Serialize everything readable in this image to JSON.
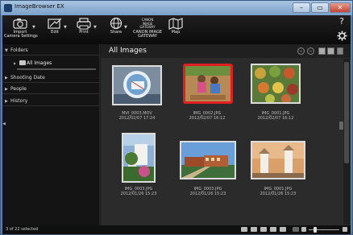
{
  "window": {
    "title": "ImageBrowser EX",
    "controls": {
      "min": "–",
      "max": "▭",
      "close": "✕"
    }
  },
  "toolbar": {
    "import_label": "Import\nCamera Settings",
    "edit_label": "Edit",
    "print_label": "Print",
    "share_label": "Share",
    "gateway_logo": "CANON\niMAGE\nGATEWAY",
    "gateway_label": "CANON iMAGE\nGATEWAY",
    "map_label": "Map",
    "help_label": "?",
    "settings_icon": "gear-icon"
  },
  "sidebar": {
    "sections": [
      {
        "label": "Folders",
        "expanded": true
      },
      {
        "label": "Shooting Date",
        "expanded": false
      },
      {
        "label": "People",
        "expanded": false
      },
      {
        "label": "History",
        "expanded": false
      }
    ],
    "selected_item": "All Images"
  },
  "main": {
    "title": "All Images",
    "thumbnails": [
      {
        "name": "MVI_0003.MOV",
        "date": "2012/02/07 17:24",
        "kind": "video",
        "selected": false
      },
      {
        "name": "IMG_0002.JPG",
        "date": "2012/02/07 16:12",
        "kind": "photo",
        "selected": true
      },
      {
        "name": "IMG_0001.JPG",
        "date": "2012/02/07 16:12",
        "kind": "photo",
        "selected": false
      },
      {
        "name": "IMG_0003.JPG",
        "date": "2012/01/26 15:23",
        "kind": "photo",
        "selected": false
      },
      {
        "name": "IMG_0003.JPG",
        "date": "2012/01/26 15:23",
        "kind": "photo",
        "selected": false
      },
      {
        "name": "IMG_0001.JPG",
        "date": "2012/01/26 15:23",
        "kind": "photo",
        "selected": false
      }
    ]
  },
  "status": {
    "selection_text": "3 of 22 selected"
  },
  "colors": {
    "selection": "#e02020",
    "background": "#2b2b2b",
    "titlebar": "#7aa0c8"
  }
}
